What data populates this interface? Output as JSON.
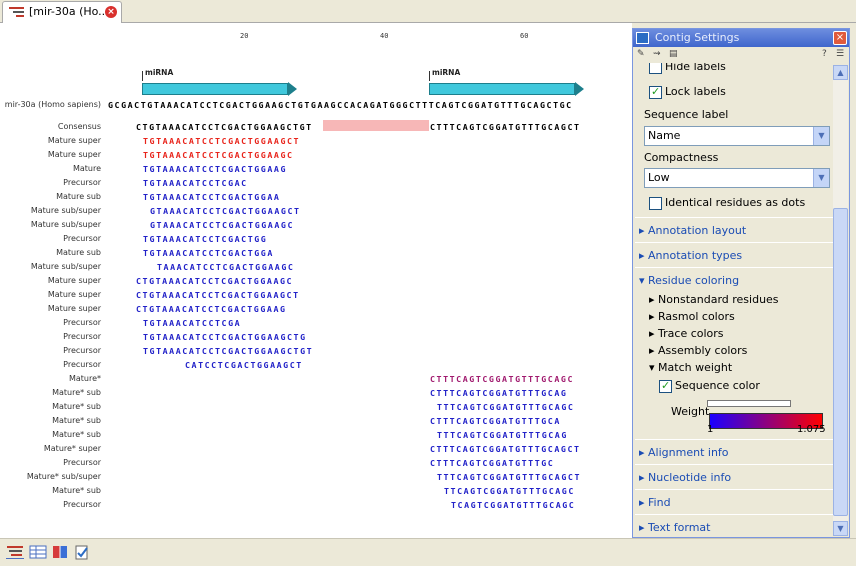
{
  "tab": {
    "title": "[mir-30a (Ho...]"
  },
  "ruler": [
    "20",
    "40",
    "60"
  ],
  "annotations": [
    {
      "label": "miRNA"
    },
    {
      "label": "miRNA"
    }
  ],
  "rows": [
    {
      "label": "mir-30a (Homo sapiens)",
      "seq": "GCGACTGTAAACATCCTCGACTGGAAGCTGTGAAGCCACAGATGGGCTTTCAGTCGGATGTTTGCAGCTGC",
      "offset": 0,
      "color": "#000"
    },
    {
      "label": "Consensus",
      "seq": "CTGTAAACATCCTCGACTGGAAGCTGT",
      "seq2": "CTTTCAGTCGGATGTTTGCAGCT",
      "offset": 4,
      "color": "#000"
    },
    {
      "label": "Mature super",
      "seq": "TGTAAACATCCTCGACTGGAAGCT",
      "offset": 5,
      "color": "#e8231a"
    },
    {
      "label": "Mature super",
      "seq": "TGTAAACATCCTCGACTGGAAGC",
      "offset": 5,
      "color": "#e8231a"
    },
    {
      "label": "Mature",
      "seq": "TGTAAACATCCTCGACTGGAAG",
      "offset": 5,
      "color": "#2121c8"
    },
    {
      "label": "Precursor",
      "seq": "TGTAAACATCCTCGAC",
      "offset": 5,
      "color": "#2121c8"
    },
    {
      "label": "Mature sub",
      "seq": "TGTAAACATCCTCGACTGGAA",
      "offset": 5,
      "color": "#2121c8"
    },
    {
      "label": "Mature sub/super",
      "seq": "GTAAACATCCTCGACTGGAAGCT",
      "offset": 6,
      "color": "#2121c8"
    },
    {
      "label": "Mature sub/super",
      "seq": "GTAAACATCCTCGACTGGAAGC",
      "offset": 6,
      "color": "#2121c8"
    },
    {
      "label": "Precursor",
      "seq": "TGTAAACATCCTCGACTGG",
      "offset": 5,
      "color": "#2121c8"
    },
    {
      "label": "Mature sub",
      "seq": "TGTAAACATCCTCGACTGGA",
      "offset": 5,
      "color": "#2121c8"
    },
    {
      "label": "Mature sub/super",
      "seq": "TAAACATCCTCGACTGGAAGC",
      "offset": 7,
      "color": "#2121c8"
    },
    {
      "label": "Mature super",
      "seq": "CTGTAAACATCCTCGACTGGAAGC",
      "offset": 4,
      "color": "#2121c8"
    },
    {
      "label": "Mature super",
      "seq": "CTGTAAACATCCTCGACTGGAAGCT",
      "offset": 4,
      "color": "#2121c8"
    },
    {
      "label": "Mature super",
      "seq": "CTGTAAACATCCTCGACTGGAAG",
      "offset": 4,
      "color": "#2121c8"
    },
    {
      "label": "Precursor",
      "seq": "TGTAAACATCCTCGA",
      "offset": 5,
      "color": "#2121c8"
    },
    {
      "label": "Precursor",
      "seq": "TGTAAACATCCTCGACTGGAAGCTG",
      "offset": 5,
      "color": "#2121c8"
    },
    {
      "label": "Precursor",
      "seq": "TGTAAACATCCTCGACTGGAAGCTGT",
      "offset": 5,
      "color": "#2121c8"
    },
    {
      "label": "Precursor",
      "seq": "CATCCTCGACTGGAAGCT",
      "offset": 11,
      "color": "#2121c8"
    },
    {
      "label": "Mature*",
      "seq": "CTTTCAGTCGGATGTTTGCAGC",
      "offset": 46,
      "color": "#a0196e"
    },
    {
      "label": "Mature* sub",
      "seq": "CTTTCAGTCGGATGTTTGCAG",
      "offset": 46,
      "color": "#2121c8"
    },
    {
      "label": "Mature* sub",
      "seq": "TTTCAGTCGGATGTTTGCAGC",
      "offset": 47,
      "color": "#2121c8"
    },
    {
      "label": "Mature* sub",
      "seq": "CTTTCAGTCGGATGTTTGCA",
      "offset": 46,
      "color": "#2121c8"
    },
    {
      "label": "Mature* sub",
      "seq": "TTTCAGTCGGATGTTTGCAG",
      "offset": 47,
      "color": "#2121c8"
    },
    {
      "label": "Mature* super",
      "seq": "CTTTCAGTCGGATGTTTGCAGCT",
      "offset": 46,
      "color": "#2121c8"
    },
    {
      "label": "Precursor",
      "seq": "CTTTCAGTCGGATGTTTGC",
      "offset": 46,
      "color": "#2121c8"
    },
    {
      "label": "Mature* sub/super",
      "seq": "TTTCAGTCGGATGTTTGCAGCT",
      "offset": 47,
      "color": "#2121c8"
    },
    {
      "label": "Mature* sub",
      "seq": "TTCAGTCGGATGTTTGCAGC",
      "offset": 48,
      "color": "#2121c8"
    },
    {
      "label": "Precursor",
      "seq": "TCAGTCGGATGTTTGCAGC",
      "offset": 49,
      "color": "#2121c8"
    }
  ],
  "panel": {
    "title": "Contig Settings",
    "hide_labels": "Hide labels",
    "lock_labels": "Lock labels",
    "sequence_label": "Sequence label",
    "sequence_label_value": "Name",
    "compactness": "Compactness",
    "compactness_value": "Low",
    "identical_dots": "Identical residues as dots",
    "annotation_layout": "Annotation layout",
    "annotation_types": "Annotation types",
    "residue_coloring": "Residue coloring",
    "nonstandard": "Nonstandard residues",
    "rasmol": "Rasmol colors",
    "trace": "Trace colors",
    "assembly": "Assembly colors",
    "match_weight": "Match weight",
    "sequence_color": "Sequence color",
    "weight": "Weight",
    "weight_min": "1",
    "weight_max": "1.075",
    "alignment_info": "Alignment info",
    "nucleotide_info": "Nucleotide info",
    "find": "Find",
    "text_format": "Text format"
  },
  "colors": {
    "accent": "#1a4cb4",
    "annotation": "#40c8dc",
    "mismatch": "#f7b7b7"
  }
}
